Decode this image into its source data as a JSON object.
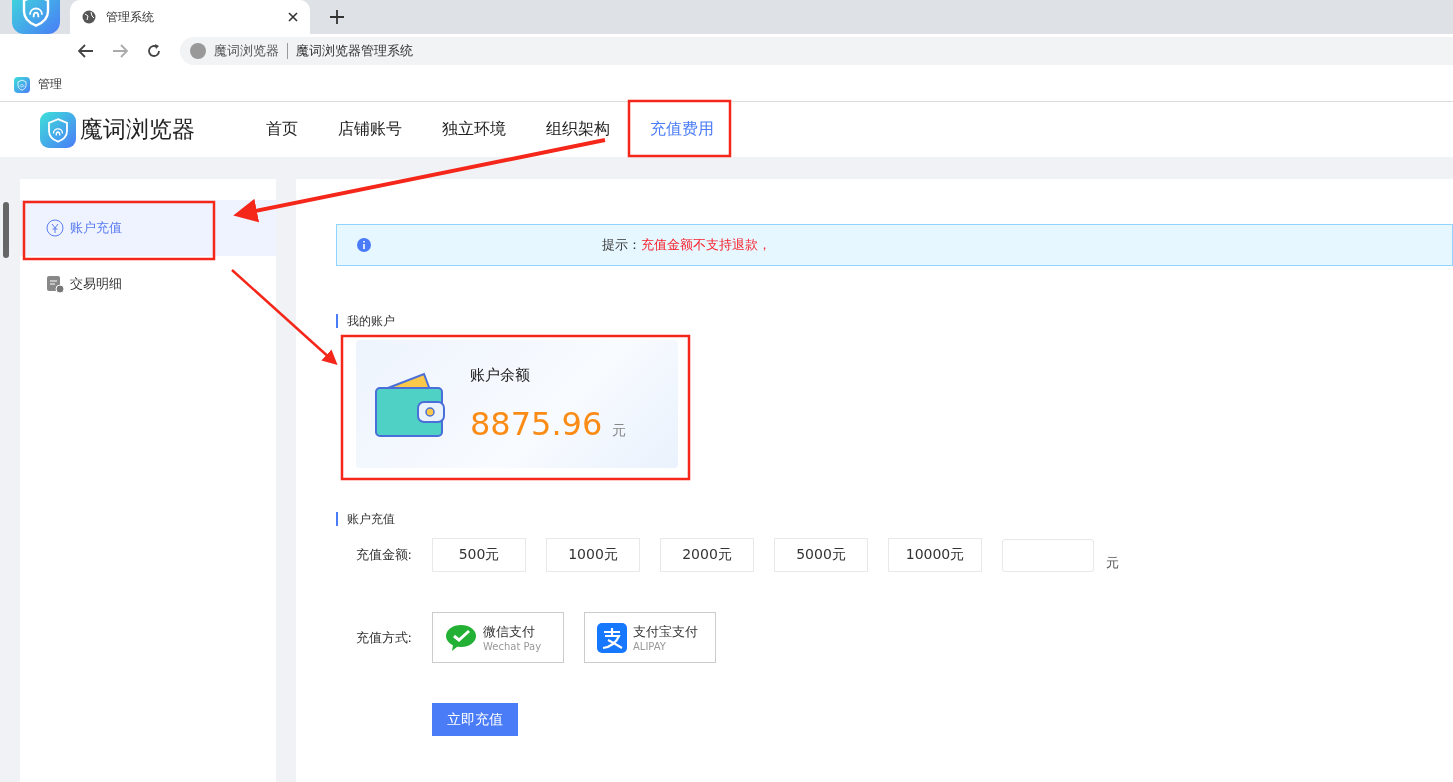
{
  "browser": {
    "tab_title": "管理系统",
    "address_site": "魔词浏览器",
    "address_title": "魔词浏览器管理系统",
    "bookmark": "管理"
  },
  "header": {
    "logo_text": "魔词浏览器",
    "nav": [
      {
        "label": "首页",
        "selected": false
      },
      {
        "label": "店铺账号",
        "selected": false
      },
      {
        "label": "独立环境",
        "selected": false
      },
      {
        "label": "组织架构",
        "selected": false
      },
      {
        "label": "充值费用",
        "selected": true
      }
    ]
  },
  "sidebar": {
    "items": [
      {
        "label": "账户充值",
        "kind": "yuan",
        "selected": true
      },
      {
        "label": "交易明细",
        "kind": "ledger",
        "selected": false
      }
    ]
  },
  "alert": {
    "label": "提示：",
    "message": "充值金额不支持退款，"
  },
  "account": {
    "title": "我的账户",
    "balance_label": "账户余额",
    "amount": "8875.96",
    "unit": "元"
  },
  "recharge": {
    "title": "账户充值",
    "amount_label": "充值金额:",
    "options": [
      "500元",
      "1000元",
      "2000元",
      "5000元",
      "10000元"
    ],
    "custom_unit": "元",
    "method_label": "充值方式:",
    "methods": [
      {
        "kind": "wechat",
        "name": "微信支付",
        "sub": "Wechat Pay"
      },
      {
        "kind": "alipay",
        "name": "支付宝支付",
        "sub": "ALIPAY"
      }
    ],
    "submit": "立即充值"
  }
}
